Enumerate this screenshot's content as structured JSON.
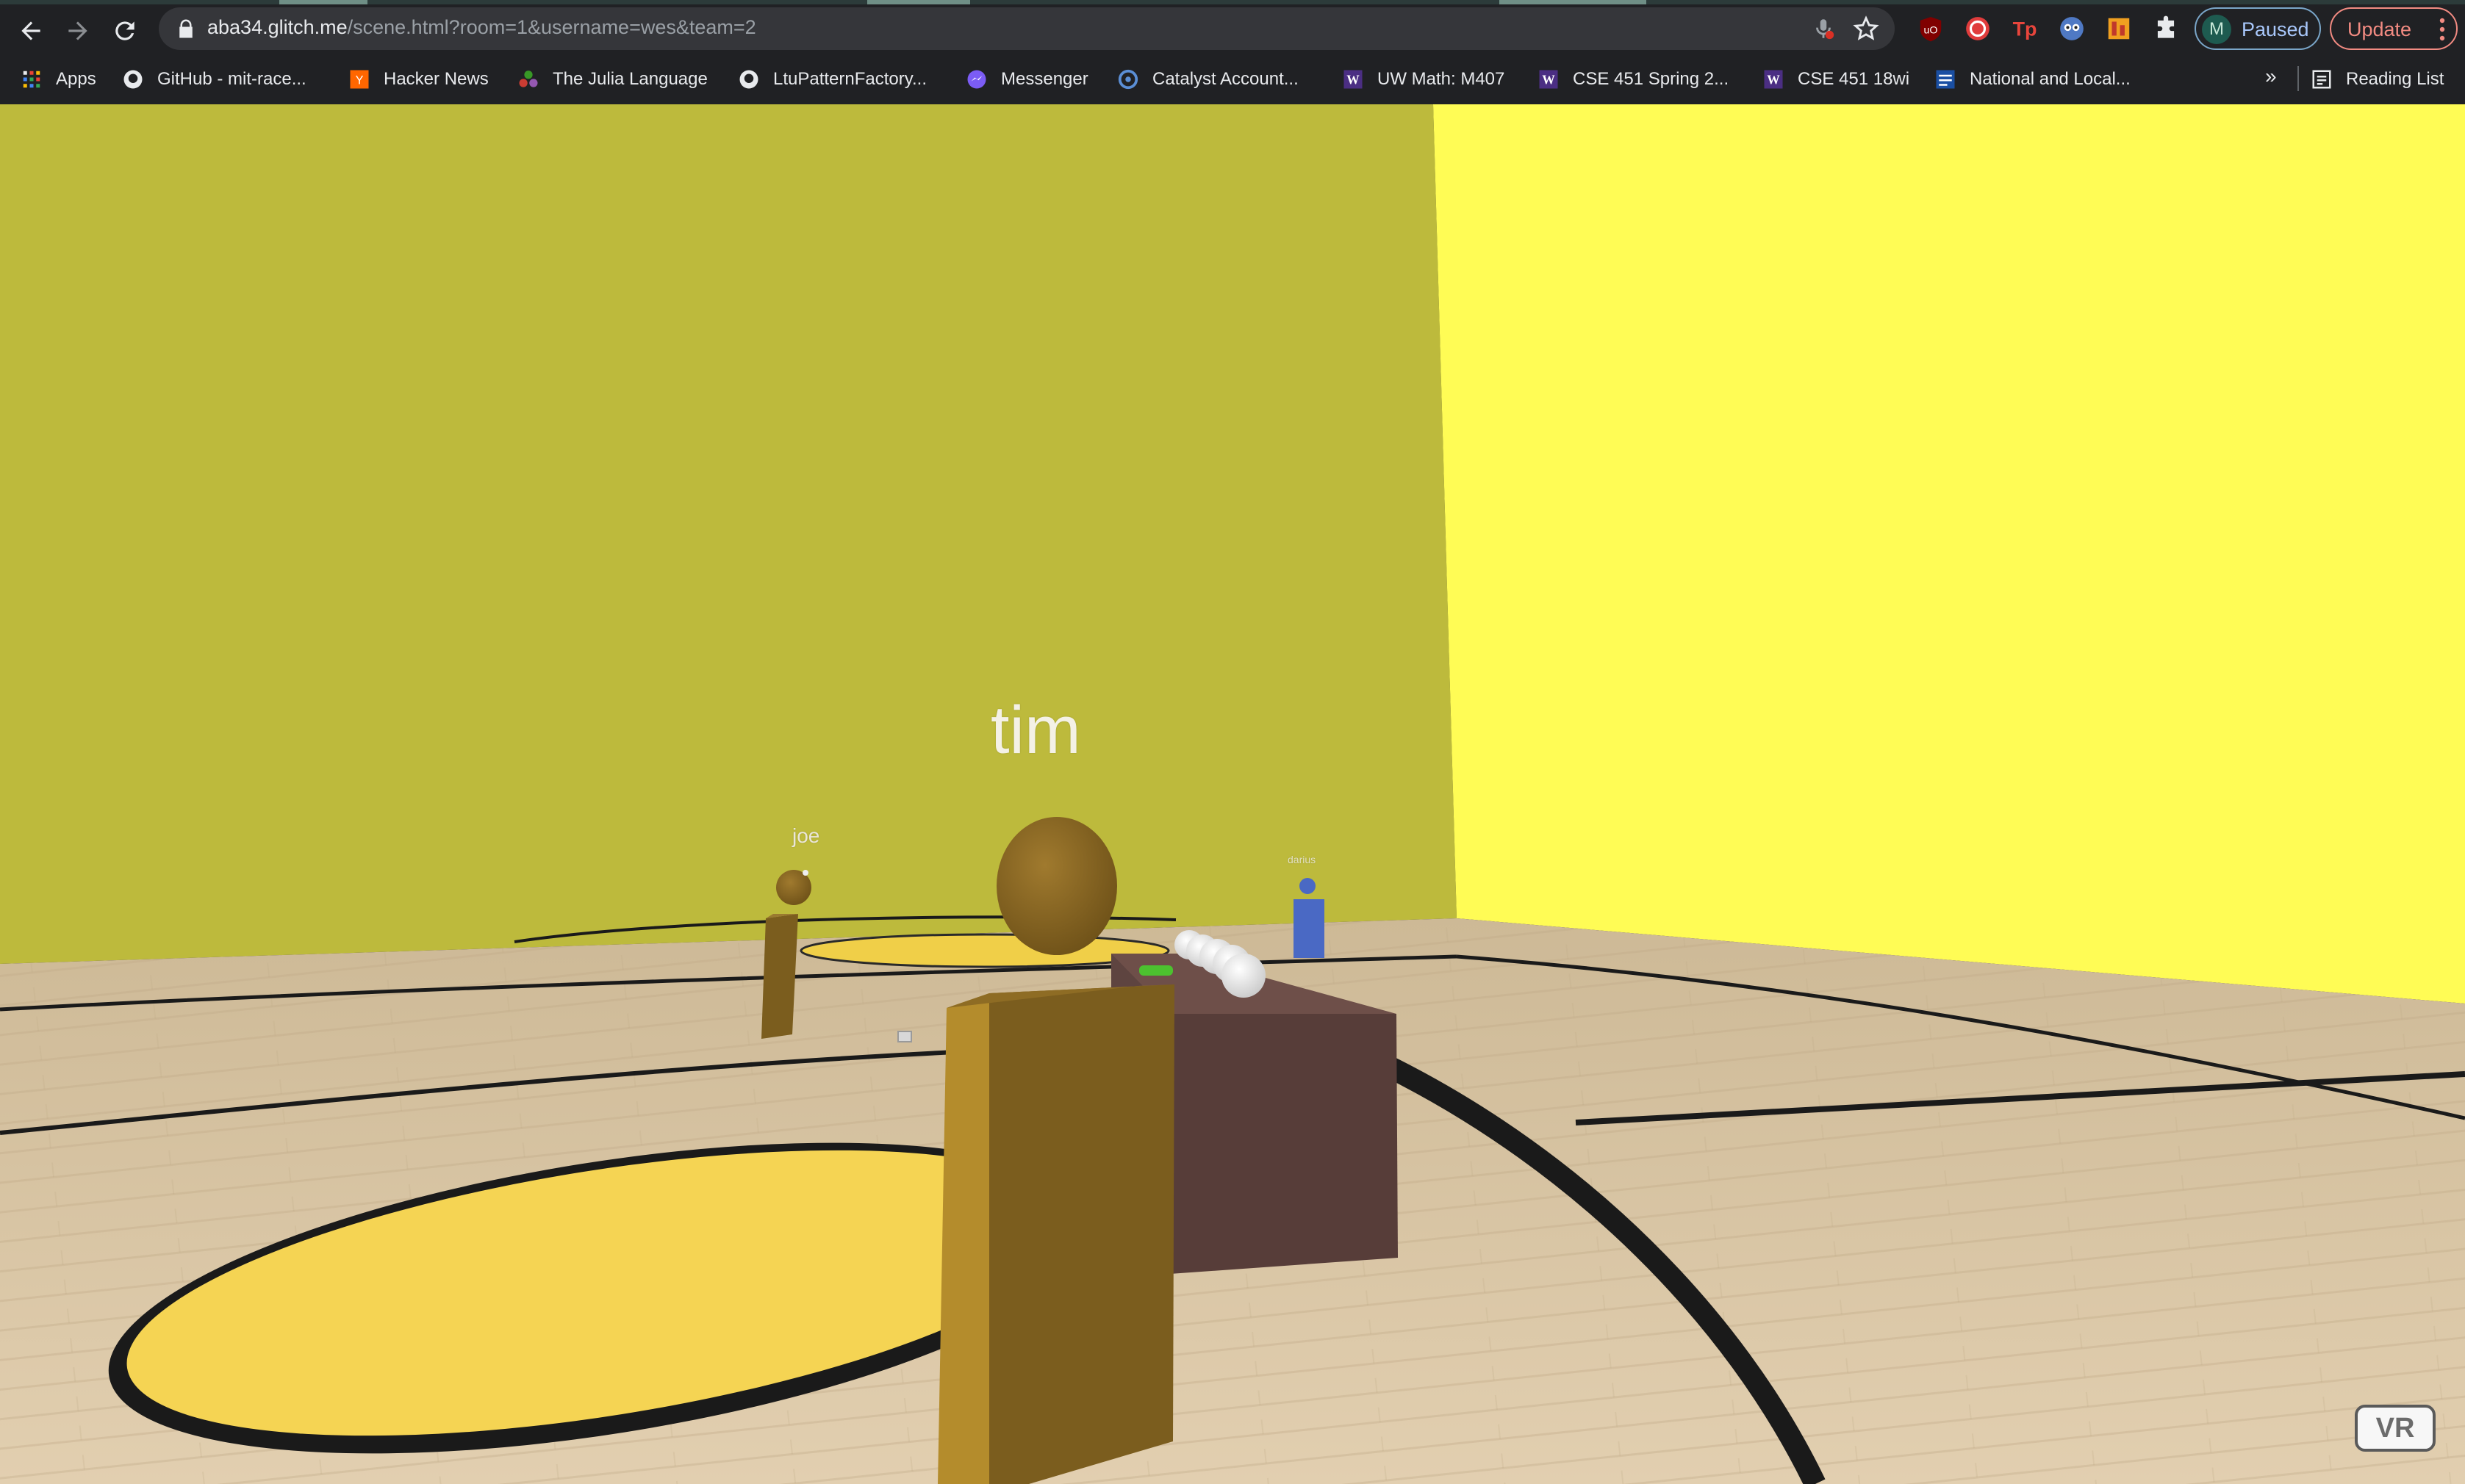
{
  "browser": {
    "url_host": "aba34.glitch.me",
    "url_path": "/scene.html?room=1&username=wes&team=2",
    "profile_initial": "M",
    "profile_status": "Paused",
    "update_label": "Update",
    "extensions": [
      "ublock-icon",
      "extension-red-circle-icon",
      "extension-tp-icon",
      "extension-owl-icon",
      "extension-orange-icon",
      "puzzle-icon"
    ]
  },
  "bookmarks": {
    "items": [
      {
        "label": "Apps",
        "icon": "apps-grid-icon"
      },
      {
        "label": "GitHub - mit-race...",
        "icon": "github-icon"
      },
      {
        "label": "Hacker News",
        "icon": "hacker-news-icon"
      },
      {
        "label": "The Julia Language",
        "icon": "julia-icon"
      },
      {
        "label": "LtuPatternFactory...",
        "icon": "github-icon"
      },
      {
        "label": "Messenger",
        "icon": "messenger-icon"
      },
      {
        "label": "Catalyst Account...",
        "icon": "catalyst-icon"
      },
      {
        "label": "UW Math: M407",
        "icon": "uw-icon"
      },
      {
        "label": "CSE 451 Spring 2...",
        "icon": "uw-icon"
      },
      {
        "label": "CSE 451 18wi",
        "icon": "uw-icon"
      },
      {
        "label": "National and Local...",
        "icon": "news-icon"
      }
    ],
    "overflow": "»",
    "reading_list": "Reading List"
  },
  "scene": {
    "players": {
      "tim": "tim",
      "joe": "joe",
      "darius": "darius"
    },
    "vr_button": "VR",
    "colors": {
      "left_wall": "#bdba3c",
      "right_wall": "#fffc55",
      "floor": "#d8c3a2",
      "court_circle": "#f5d453",
      "player_body": "#7b5d1e",
      "table_top": "#6e4f49",
      "table_front": "#573d39",
      "teammate": "#4a69c4",
      "ball": "#eeeeee",
      "paddle": "#4cc12f"
    }
  }
}
